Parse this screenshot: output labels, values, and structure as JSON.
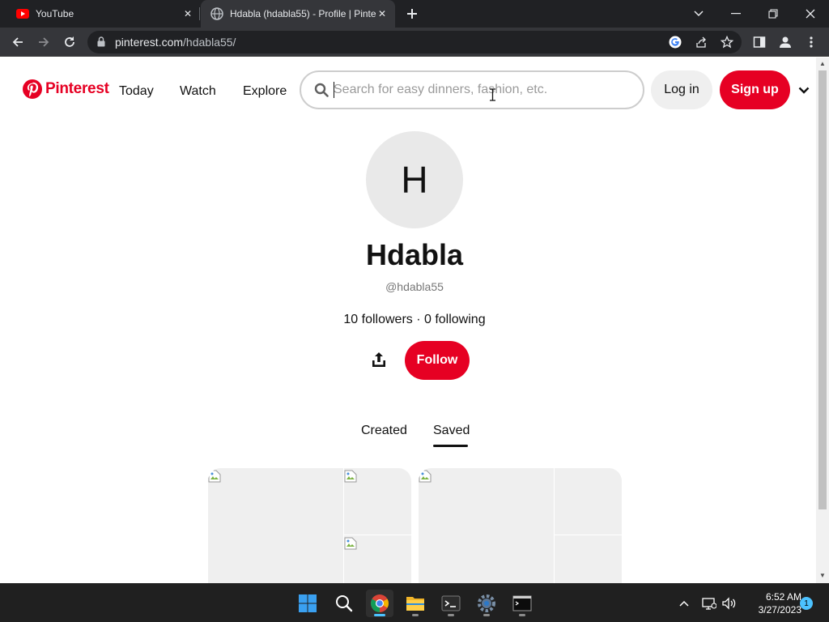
{
  "browser": {
    "tabs": [
      {
        "title": "YouTube",
        "favicon": "youtube-icon"
      },
      {
        "title": "Hdabla (hdabla55) - Profile | Pinte",
        "favicon": "globe-icon"
      }
    ],
    "url_host": "pinterest.com",
    "url_path": "/hdabla55/"
  },
  "header": {
    "logo_text": "Pinterest",
    "nav": [
      "Today",
      "Watch",
      "Explore"
    ],
    "search_placeholder": "Search for easy dinners, fashion, etc.",
    "login_label": "Log in",
    "signup_label": "Sign up"
  },
  "profile": {
    "initial": "H",
    "name": "Hdabla",
    "handle": "@hdabla55",
    "stats": "10 followers · 0 following",
    "follow_label": "Follow"
  },
  "tabs": {
    "created": "Created",
    "saved": "Saved",
    "active": "Saved"
  },
  "taskbar": {
    "time": "6:52 AM",
    "date": "3/27/2023",
    "notification_count": "1",
    "apps": [
      "windows-start-icon",
      "search-icon",
      "chrome-icon",
      "file-explorer-icon",
      "terminal-icon",
      "settings-icon",
      "command-prompt-icon"
    ]
  },
  "colors": {
    "brand": "#e60023",
    "chrome_dark": "#202124",
    "chrome_toolbar": "#35363a"
  }
}
